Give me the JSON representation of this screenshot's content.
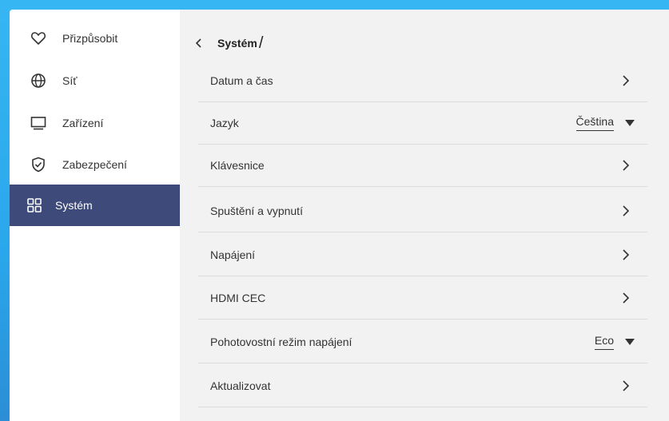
{
  "sidebar": {
    "items": [
      {
        "label": "Přizpůsobit",
        "icon": "heart-icon"
      },
      {
        "label": "Síť",
        "icon": "globe-icon"
      },
      {
        "label": "Zařízení",
        "icon": "monitor-icon"
      },
      {
        "label": "Zabezpečení",
        "icon": "shield-check-icon"
      },
      {
        "label": "Systém",
        "icon": "grid-icon",
        "active": true
      }
    ]
  },
  "header": {
    "breadcrumb": "Systém",
    "separator": "/"
  },
  "settings": {
    "rows": [
      {
        "label": "Datum a čas"
      },
      {
        "label": "Jazyk",
        "value": "Čeština"
      },
      {
        "label": "Klávesnice"
      },
      {
        "label": "Spuštění a vypnutí"
      },
      {
        "label": "Napájení"
      },
      {
        "label": "HDMI CEC"
      },
      {
        "label": "Pohotovostní režim napájení",
        "value": "Eco"
      },
      {
        "label": "Aktualizovat"
      }
    ]
  },
  "colors": {
    "accent": "#3d4a7a",
    "background": "#f2f2f2",
    "sidebar": "#ffffff",
    "frame": "#36b6f2"
  }
}
